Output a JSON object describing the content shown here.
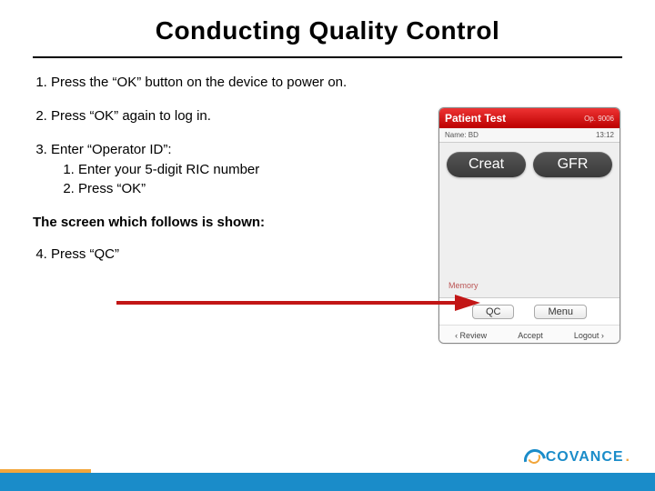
{
  "title": "Conducting Quality Control",
  "steps": {
    "s1": "Press the “OK” button on the device to power on.",
    "s2": "Press “OK” again to log in.",
    "s3": "Enter “Operator ID”:",
    "s3a": "Enter your 5-digit RIC number",
    "s3b": "Press “OK”",
    "shown": "The screen which follows is shown:",
    "s4": "Press “QC”"
  },
  "device": {
    "header": "Patient Test",
    "header_right": "Op. 9006",
    "sub_left": "Name: BD",
    "sub_right": "13:12",
    "btn_creat": "Creat",
    "btn_gfr": "GFR",
    "memory": "Memory",
    "qc": "QC",
    "menu": "Menu",
    "review": "‹ Review",
    "accept": "Accept",
    "logout": "Logout ›"
  },
  "brand": {
    "name": "COVANCE",
    "dot": "."
  }
}
